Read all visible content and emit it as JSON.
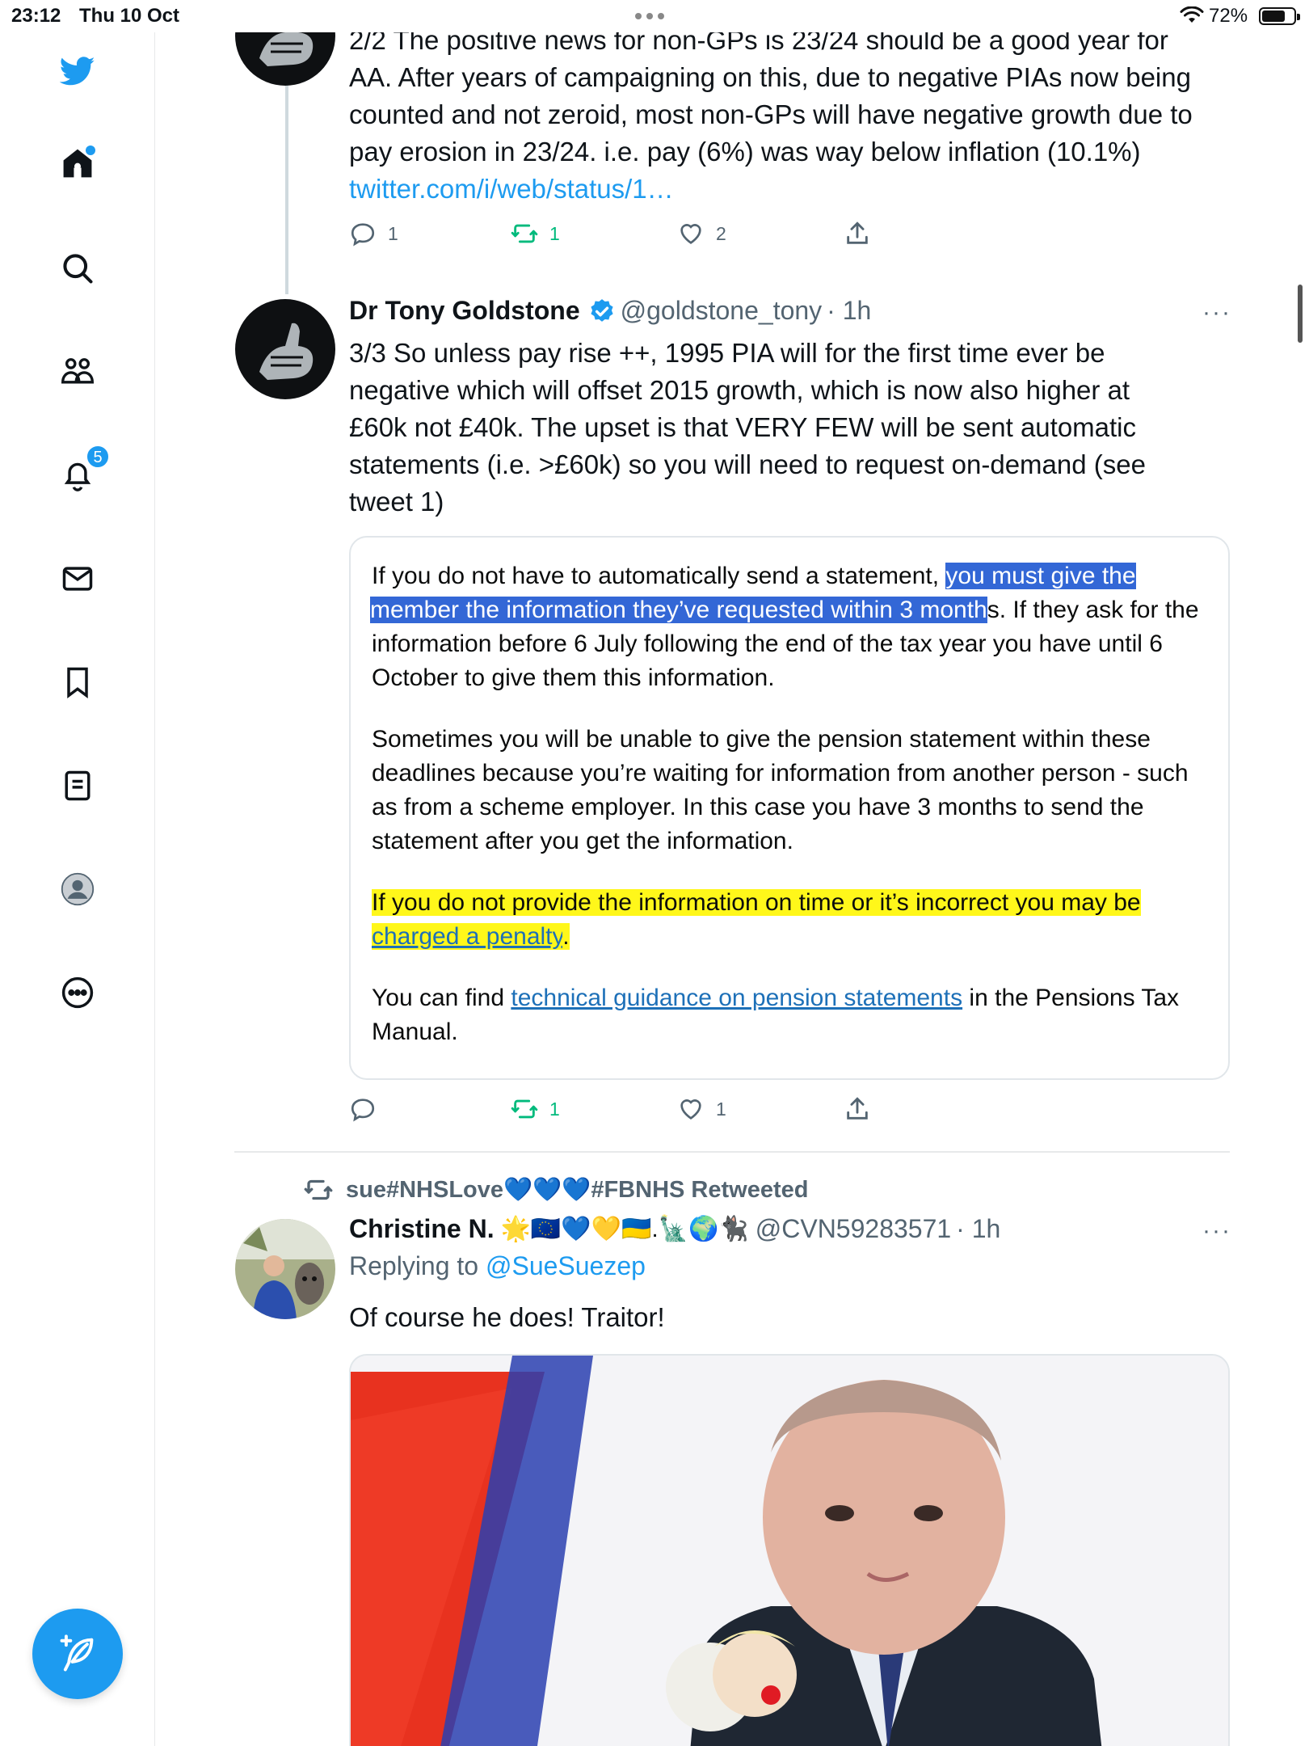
{
  "status_bar": {
    "time": "23:12",
    "date": "Thu 10 Oct",
    "battery": "72%"
  },
  "sidebar": {
    "notification_count": "5",
    "items": [
      "twitter-logo",
      "home-icon",
      "search-icon",
      "communities-icon",
      "notifications-icon",
      "messages-icon",
      "bookmarks-icon",
      "lists-icon",
      "profile-icon",
      "more-icon"
    ]
  },
  "tweet1": {
    "text_lines": [
      "2/2 The positive news for non-GPs is 23/24 should be a good year for",
      "AA. After years of campaigning on this, due to negative PIAs now being",
      "counted and not zeroid, most non-GPs will have negative growth due to",
      "pay erosion in 23/24. i.e. pay (6%) was way below inflation (10.1%)"
    ],
    "link": "twitter.com/i/web/status/1…",
    "replies": "1",
    "retweets": "1",
    "likes": "2"
  },
  "tweet2": {
    "name": "Dr Tony Goldstone",
    "handle": "@goldstone_tony",
    "time": "· 1h",
    "text_lines": [
      "3/3 So unless pay rise ++, 1995 PIA will for the first time ever be",
      "negative which will offset 2015 growth, which is now also higher at",
      "£60k not £40k. The upset is that VERY FEW will be sent automatic",
      "statements (i.e. >£60k) so you will need to request on-demand (see",
      "tweet 1)"
    ],
    "card": {
      "p1_pre": "If you do not have to automatically send a statement, ",
      "p1_sel1": "you must give the",
      "p1_sel2": "member the information they’ve requested within 3 month",
      "p1_post2": "s. If they ask for the",
      "p1_line3": "information before 6 July following the end of the tax year you have until 6",
      "p1_line4": "October to give them this information.",
      "p2_lines": [
        "Sometimes you will be unable to give the pension statement within these",
        "deadlines because you’re waiting for information from another person - such",
        "as from a scheme employer. In this case you have 3 months to send the",
        "statement after you get the information."
      ],
      "p3_line1": "If you do not provide the information on time or it’s incorrect you may be",
      "p3_link": "charged a penalty",
      "p3_end": ".",
      "p4_pre": "You can find ",
      "p4_link": "technical guidance on pension statements",
      "p4_post": " in the Pensions Tax",
      "p4_line2": "Manual."
    },
    "replies": "",
    "retweets": "1",
    "likes": "1"
  },
  "tweet3": {
    "retweeted_by": "sue#NHSLove💙💙💙#FBNHS Retweeted",
    "name": "Christine N.",
    "name_emojis": "🌟🇪🇺💙💛🇺🇦.🗽🌍🐈‍⬛",
    "handle": "@CVN59283571",
    "time": "· 1h",
    "replying_to_label": "Replying to ",
    "replying_to_handle": "@SueSuezep",
    "text": "Of course he does! Traitor!"
  },
  "colors": {
    "accent": "#1d9bf0",
    "retweet": "#00ba7c",
    "selection": "#3367d6",
    "highlight": "#fff71a",
    "gov_link": "#1d70b8"
  }
}
